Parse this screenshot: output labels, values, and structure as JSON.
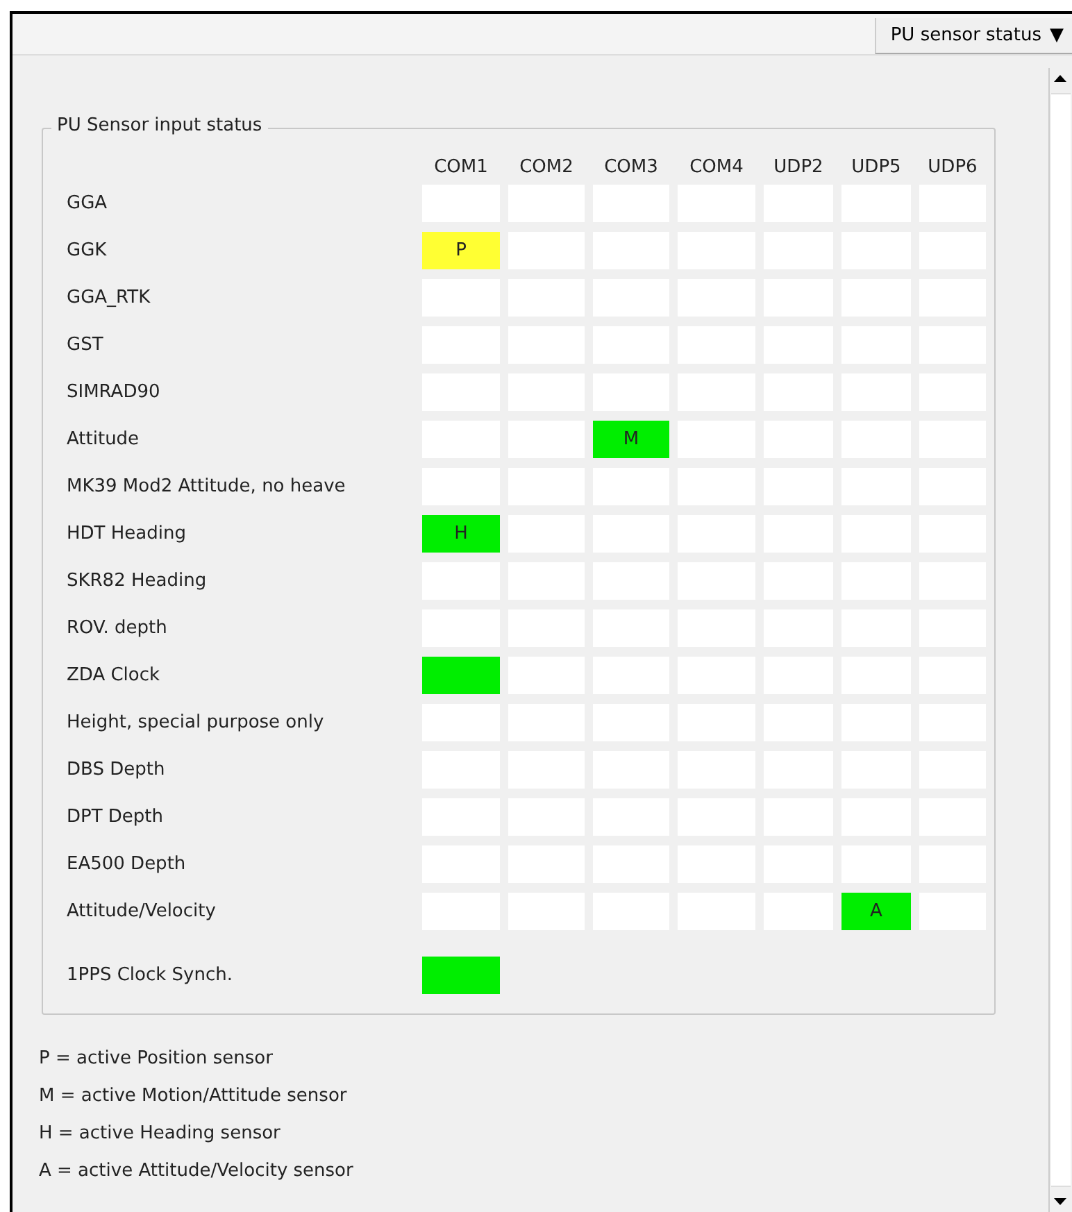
{
  "dropdown": {
    "label": "PU sensor status",
    "arrow": "▼"
  },
  "group": {
    "title": "PU Sensor input status",
    "columns": [
      "COM1",
      "COM2",
      "COM3",
      "COM4",
      "UDP2",
      "UDP5",
      "UDP6"
    ],
    "rows": [
      {
        "label": "GGA",
        "cells": [
          {
            "color": "#ffffff"
          },
          {
            "color": "#ffffff"
          },
          {
            "color": "#ffffff"
          },
          {
            "color": "#ffffff"
          },
          {
            "color": "#ffffff"
          },
          {
            "color": "#ffffff"
          },
          {
            "color": "#ffffff"
          }
        ]
      },
      {
        "label": "GGK",
        "cells": [
          {
            "color": "#ffff33",
            "text": "P"
          },
          {
            "color": "#ffffff"
          },
          {
            "color": "#ffffff"
          },
          {
            "color": "#ffffff"
          },
          {
            "color": "#ffffff"
          },
          {
            "color": "#ffffff"
          },
          {
            "color": "#ffffff"
          }
        ]
      },
      {
        "label": "GGA_RTK",
        "cells": [
          {
            "color": "#ffffff"
          },
          {
            "color": "#ffffff"
          },
          {
            "color": "#ffffff"
          },
          {
            "color": "#ffffff"
          },
          {
            "color": "#ffffff"
          },
          {
            "color": "#ffffff"
          },
          {
            "color": "#ffffff"
          }
        ]
      },
      {
        "label": "GST",
        "cells": [
          {
            "color": "#ffffff"
          },
          {
            "color": "#ffffff"
          },
          {
            "color": "#ffffff"
          },
          {
            "color": "#ffffff"
          },
          {
            "color": "#ffffff"
          },
          {
            "color": "#ffffff"
          },
          {
            "color": "#ffffff"
          }
        ]
      },
      {
        "label": "SIMRAD90",
        "cells": [
          {
            "color": "#ffffff"
          },
          {
            "color": "#ffffff"
          },
          {
            "color": "#ffffff"
          },
          {
            "color": "#ffffff"
          },
          {
            "color": "#ffffff"
          },
          {
            "color": "#ffffff"
          },
          {
            "color": "#ffffff"
          }
        ]
      },
      {
        "label": "Attitude",
        "cells": [
          {
            "color": "#ffffff"
          },
          {
            "color": "#ffffff"
          },
          {
            "color": "#00ee00",
            "text": "M"
          },
          {
            "color": "#ffffff"
          },
          {
            "color": "#ffffff"
          },
          {
            "color": "#ffffff"
          },
          {
            "color": "#ffffff"
          }
        ]
      },
      {
        "label": "MK39 Mod2 Attitude, no heave",
        "cells": [
          {
            "color": "#ffffff"
          },
          {
            "color": "#ffffff"
          },
          {
            "color": "#ffffff"
          },
          {
            "color": "#ffffff"
          },
          {
            "color": "#ffffff"
          },
          {
            "color": "#ffffff"
          },
          {
            "color": "#ffffff"
          }
        ]
      },
      {
        "label": "HDT Heading",
        "cells": [
          {
            "color": "#00ee00",
            "text": "H"
          },
          {
            "color": "#ffffff"
          },
          {
            "color": "#ffffff"
          },
          {
            "color": "#ffffff"
          },
          {
            "color": "#ffffff"
          },
          {
            "color": "#ffffff"
          },
          {
            "color": "#ffffff"
          }
        ]
      },
      {
        "label": "SKR82 Heading",
        "cells": [
          {
            "color": "#ffffff"
          },
          {
            "color": "#ffffff"
          },
          {
            "color": "#ffffff"
          },
          {
            "color": "#ffffff"
          },
          {
            "color": "#ffffff"
          },
          {
            "color": "#ffffff"
          },
          {
            "color": "#ffffff"
          }
        ]
      },
      {
        "label": "ROV. depth",
        "cells": [
          {
            "color": "#ffffff"
          },
          {
            "color": "#ffffff"
          },
          {
            "color": "#ffffff"
          },
          {
            "color": "#ffffff"
          },
          {
            "color": "#ffffff"
          },
          {
            "color": "#ffffff"
          },
          {
            "color": "#ffffff"
          }
        ]
      },
      {
        "label": "ZDA Clock",
        "cells": [
          {
            "color": "#00ee00"
          },
          {
            "color": "#ffffff"
          },
          {
            "color": "#ffffff"
          },
          {
            "color": "#ffffff"
          },
          {
            "color": "#ffffff"
          },
          {
            "color": "#ffffff"
          },
          {
            "color": "#ffffff"
          }
        ]
      },
      {
        "label": "Height, special purpose only",
        "cells": [
          {
            "color": "#ffffff"
          },
          {
            "color": "#ffffff"
          },
          {
            "color": "#ffffff"
          },
          {
            "color": "#ffffff"
          },
          {
            "color": "#ffffff"
          },
          {
            "color": "#ffffff"
          },
          {
            "color": "#ffffff"
          }
        ]
      },
      {
        "label": "DBS Depth",
        "cells": [
          {
            "color": "#ffffff"
          },
          {
            "color": "#ffffff"
          },
          {
            "color": "#ffffff"
          },
          {
            "color": "#ffffff"
          },
          {
            "color": "#ffffff"
          },
          {
            "color": "#ffffff"
          },
          {
            "color": "#ffffff"
          }
        ]
      },
      {
        "label": "DPT Depth",
        "cells": [
          {
            "color": "#ffffff"
          },
          {
            "color": "#ffffff"
          },
          {
            "color": "#ffffff"
          },
          {
            "color": "#ffffff"
          },
          {
            "color": "#ffffff"
          },
          {
            "color": "#ffffff"
          },
          {
            "color": "#ffffff"
          }
        ]
      },
      {
        "label": "EA500 Depth",
        "cells": [
          {
            "color": "#ffffff"
          },
          {
            "color": "#ffffff"
          },
          {
            "color": "#ffffff"
          },
          {
            "color": "#ffffff"
          },
          {
            "color": "#ffffff"
          },
          {
            "color": "#ffffff"
          },
          {
            "color": "#ffffff"
          }
        ]
      },
      {
        "label": "Attitude/Velocity",
        "cells": [
          {
            "color": "#ffffff"
          },
          {
            "color": "#ffffff"
          },
          {
            "color": "#ffffff"
          },
          {
            "color": "#ffffff"
          },
          {
            "color": "#ffffff"
          },
          {
            "color": "#00ee00",
            "text": "A"
          },
          {
            "color": "#ffffff"
          }
        ]
      }
    ],
    "sync_row": {
      "label": "1PPS Clock Synch.",
      "cells": [
        {
          "color": "#00ee00"
        }
      ]
    }
  },
  "legend": [
    "P = active Position sensor",
    "M = active Motion/Attitude sensor",
    "H = active Heading sensor",
    "A = active Attitude/Velocity sensor"
  ]
}
